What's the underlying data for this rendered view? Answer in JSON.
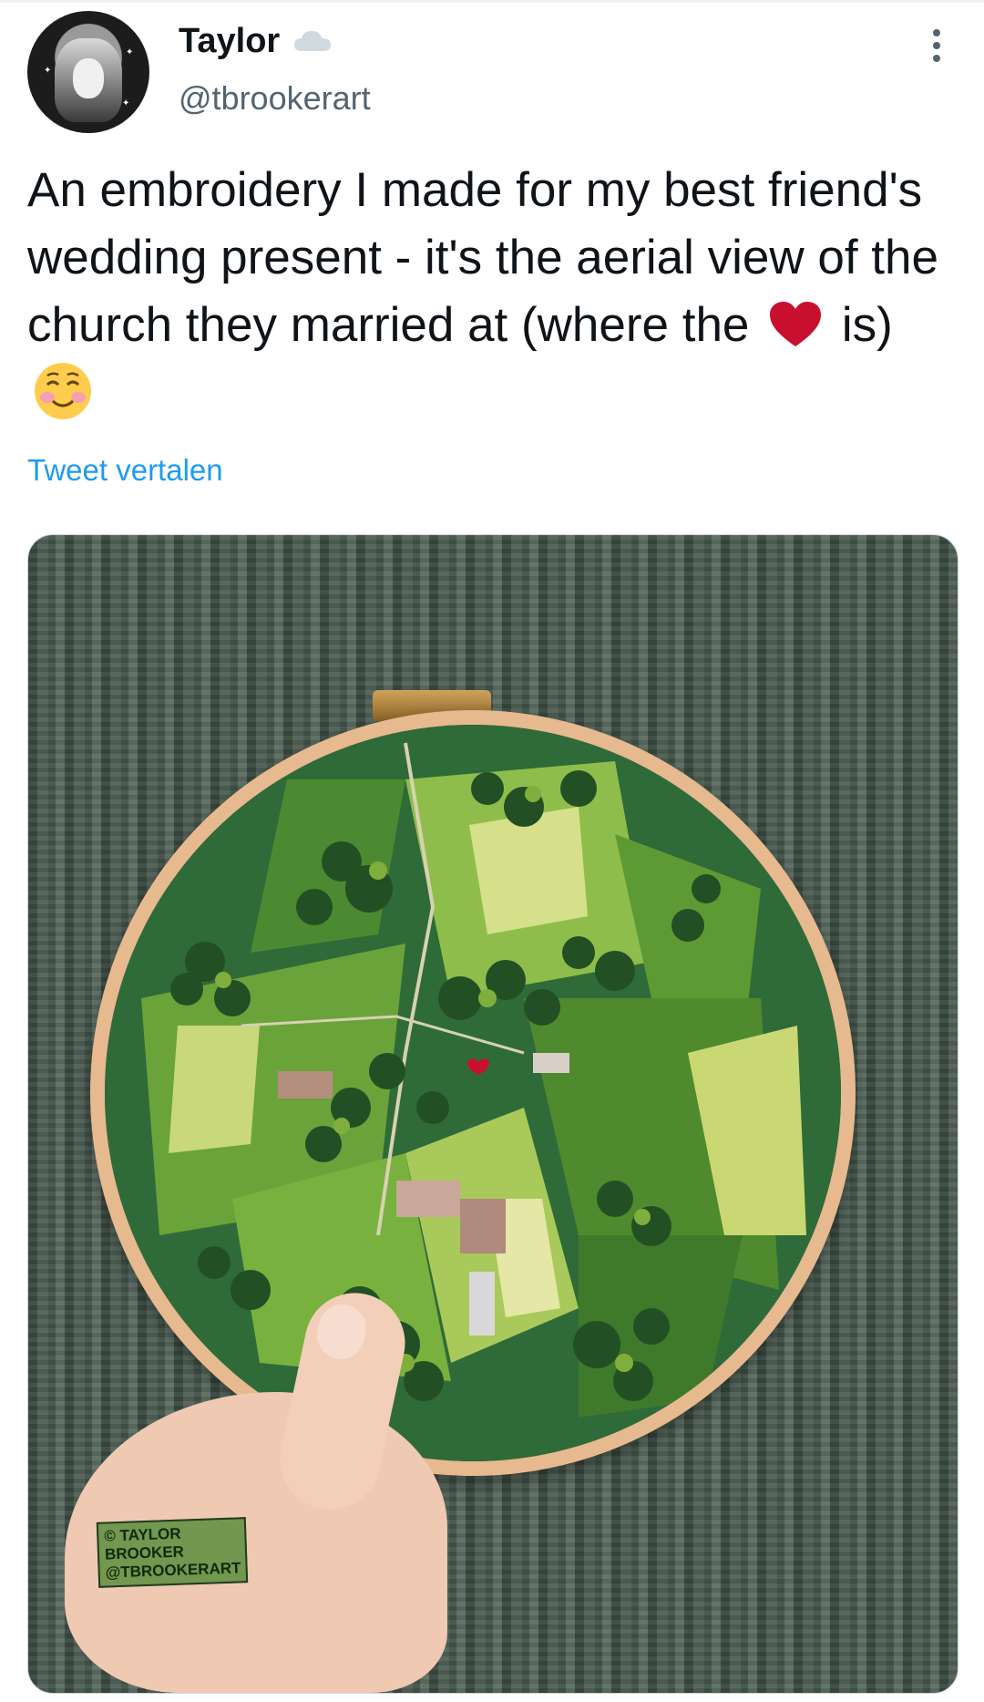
{
  "author": {
    "display_name": "Taylor",
    "handle": "@tbrookerart",
    "avatar_icon": "avatar-portrait",
    "badge_icon": "cloud-icon"
  },
  "tweet": {
    "text_part1": "An embroidery I made for my best friend's wedding present - it's the aerial view of the church they married at (where the",
    "text_part2": "is)",
    "emoji_1": "red-heart",
    "emoji_2": "smiling-face-with-smiling-eyes",
    "translate_label": "Tweet vertalen"
  },
  "media": {
    "watermark_line1": "© TAYLOR BROOKER",
    "watermark_line2": "@TBROOKERART"
  },
  "colors": {
    "link": "#1d9bf0",
    "secondary_text": "#536471",
    "primary_text": "#0f1419"
  }
}
